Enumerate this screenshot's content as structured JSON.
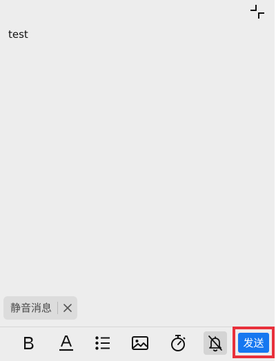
{
  "editor": {
    "content": "test"
  },
  "header": {
    "collapse_icon": "collapse-icon"
  },
  "silent_chip": {
    "label": "静音消息",
    "close_icon": "close-icon"
  },
  "toolbar": {
    "items": [
      {
        "name": "bold",
        "icon": "bold-icon"
      },
      {
        "name": "text-color",
        "icon": "text-color-icon"
      },
      {
        "name": "list",
        "icon": "list-icon"
      },
      {
        "name": "image",
        "icon": "image-icon"
      },
      {
        "name": "timer",
        "icon": "timer-icon"
      },
      {
        "name": "mute",
        "icon": "bell-off-icon",
        "active": true
      }
    ],
    "send_label": "发送"
  },
  "colors": {
    "background": "#ededed",
    "send_button": "#1677f0",
    "highlight_border": "#e8303b",
    "chip_background": "#dcdcdc"
  }
}
